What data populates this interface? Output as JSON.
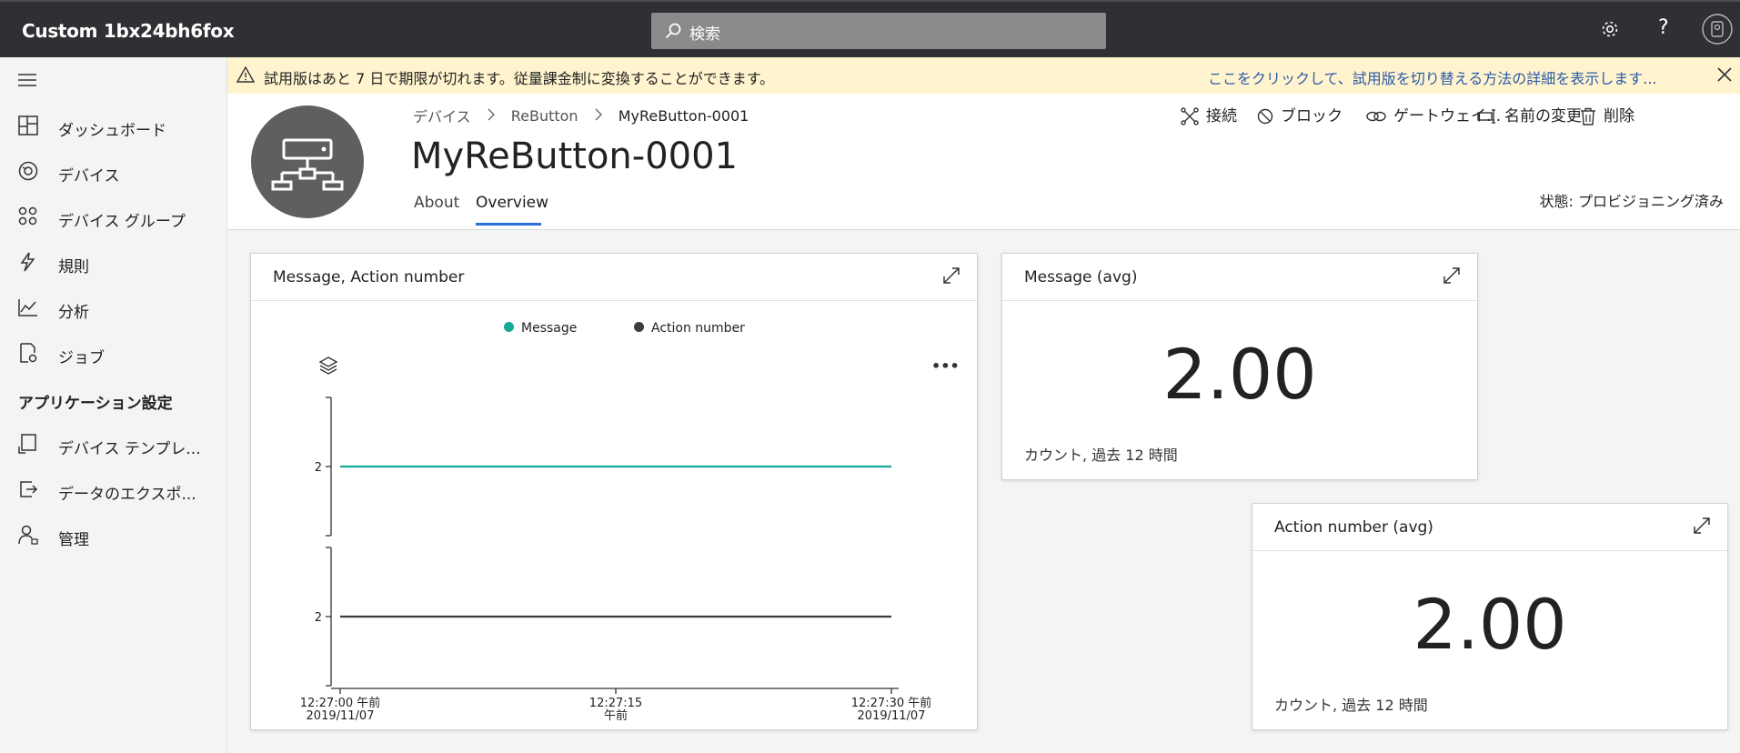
{
  "app": {
    "title": "Custom 1bx24bh6fox"
  },
  "search": {
    "placeholder": "検索"
  },
  "topbar": {
    "icons": [
      "gear-icon",
      "help-icon",
      "user-avatar-icon"
    ],
    "help_glyph": "?"
  },
  "sidebar": {
    "items": [
      {
        "label": "ダッシュボード",
        "icon": "dashboard-icon"
      },
      {
        "label": "デバイス",
        "icon": "devices-icon"
      },
      {
        "label": "デバイス グループ",
        "icon": "device-groups-icon"
      },
      {
        "label": "規則",
        "icon": "rules-icon"
      },
      {
        "label": "分析",
        "icon": "analytics-icon"
      },
      {
        "label": "ジョブ",
        "icon": "jobs-icon"
      }
    ],
    "section_title": "アプリケーション設定",
    "settings_items": [
      {
        "label": "デバイス テンプレ...",
        "icon": "device-template-icon"
      },
      {
        "label": "データのエクスポ...",
        "icon": "data-export-icon"
      },
      {
        "label": "管理",
        "icon": "admin-icon"
      }
    ]
  },
  "banner": {
    "text": "試用版はあと 7 日で期限が切れます。従量課金制に変換することができます。",
    "link": "ここをクリックして、試用版を切り替える方法の詳細を表示します..."
  },
  "breadcrumb": [
    "デバイス",
    "ReButton",
    "MyReButton-0001"
  ],
  "device": {
    "name": "MyReButton-0001",
    "state": "状態: プロビジョニング済み"
  },
  "tabs": [
    {
      "label": "About"
    },
    {
      "label": "Overview",
      "active": true
    }
  ],
  "actions": [
    {
      "label": "接続",
      "icon": "connect-icon"
    },
    {
      "label": "ブロック",
      "icon": "block-icon"
    },
    {
      "label": "ゲートウェイ...",
      "icon": "gateway-icon"
    },
    {
      "label": "名前の変更",
      "icon": "rename-icon"
    },
    {
      "label": "削除",
      "icon": "delete-icon"
    }
  ],
  "colors": {
    "accent": "#2b6ed8",
    "series_message": "#17a99b",
    "series_action": "#3c3c3c",
    "topbar": "#2f3033",
    "banner": "#fff4ce"
  },
  "chart_card": {
    "title": "Message, Action number",
    "legend": [
      {
        "name": "Message",
        "color": "#17a99b"
      },
      {
        "name": "Action number",
        "color": "#3c3c3c"
      }
    ]
  },
  "chart_data": {
    "type": "line",
    "title": "Message, Action number",
    "x": [
      "12:27:00 午前 2019/11/07",
      "12:27:15 午前",
      "12:27:30 午前 2019/11/07"
    ],
    "x_tick_labels": [
      [
        "12:27:00 午前",
        "2019/11/07"
      ],
      [
        "12:27:15",
        "午前"
      ],
      [
        "12:27:30 午前",
        "2019/11/07"
      ]
    ],
    "series": [
      {
        "name": "Message",
        "values": [
          2,
          2,
          2
        ],
        "y_tick": "2"
      },
      {
        "name": "Action number",
        "values": [
          2,
          2,
          2
        ],
        "y_tick": "2"
      }
    ],
    "legend_position": "top-center",
    "grid": false
  },
  "kpi_message": {
    "title": "Message (avg)",
    "value": "2.00",
    "sub": "カウント, 過去 12 時間"
  },
  "kpi_action": {
    "title": "Action number (avg)",
    "value": "2.00",
    "sub": "カウント, 過去 12 時間"
  },
  "chart_toolbar": {
    "more": "•••"
  }
}
